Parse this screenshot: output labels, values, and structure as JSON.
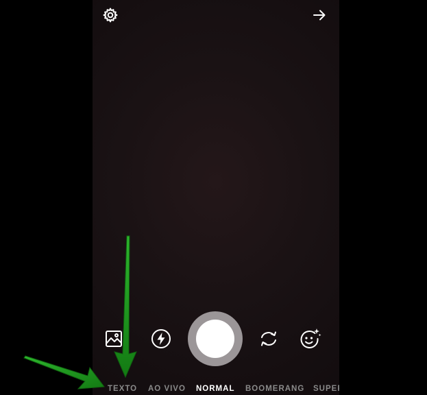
{
  "top_bar": {
    "settings_icon": "gear-icon",
    "forward_icon": "arrow-right-icon"
  },
  "controls": {
    "gallery_icon": "gallery-image-icon",
    "flash_icon": "flash-icon",
    "flip_icon": "flip-camera-icon",
    "effects_icon": "face-effects-icon"
  },
  "modes": [
    {
      "label": "TEXTO"
    },
    {
      "label": "AO VIVO"
    },
    {
      "label": "NORMAL"
    },
    {
      "label": "BOOMERANG"
    },
    {
      "label": "SUPER"
    }
  ],
  "selected_mode": "NORMAL",
  "annotation": {
    "arrow_color": "#1f9a1f",
    "arrow_count": 2,
    "target": "TEXTO"
  }
}
